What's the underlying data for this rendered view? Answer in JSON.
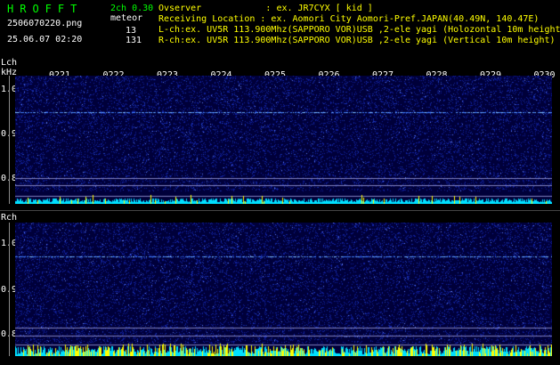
{
  "header": {
    "app_title": "HROFFT",
    "version": "2ch 0.30",
    "filename": "2506070220.png",
    "meteor_label": "meteor",
    "datetime": "25.06.07 02:20",
    "lch_count": "13",
    "rch_count": "131",
    "observer": "Ovserver            : ex. JR7CYX [ kid ]",
    "location": "Receiving Location : ex. Aomori City Aomori-Pref.JAPAN(40.49N, 140.47E)",
    "lch_desc": "L-ch:ex. UV5R 113.900Mhz(SAPPORO VOR)USB ,2-ele yagi (Holozontal 10m height)",
    "rch_desc": "R-ch:ex. UV5R 113.900Mhz(SAPPORO VOR)USB ,2-ele yagi (Vertical 10m height)"
  },
  "lch": {
    "label": "Lch",
    "unit": "kHz",
    "ticks": [
      "1.0",
      "0.9",
      "0.8"
    ]
  },
  "rch": {
    "label": "Rch",
    "ticks": [
      "1.0",
      "0.9",
      "0.8"
    ]
  },
  "time_ticks": [
    "0221",
    "0222",
    "0223",
    "0224",
    "0225",
    "0226",
    "0227",
    "0228",
    "0229",
    "0230"
  ],
  "colors": {
    "background": "#000000",
    "waterfall": "#000040",
    "title_green": "#00ff00",
    "header_yellow": "#ffff00",
    "signal_cyan": "#00ffff",
    "signal_yellow": "#ffff00"
  }
}
